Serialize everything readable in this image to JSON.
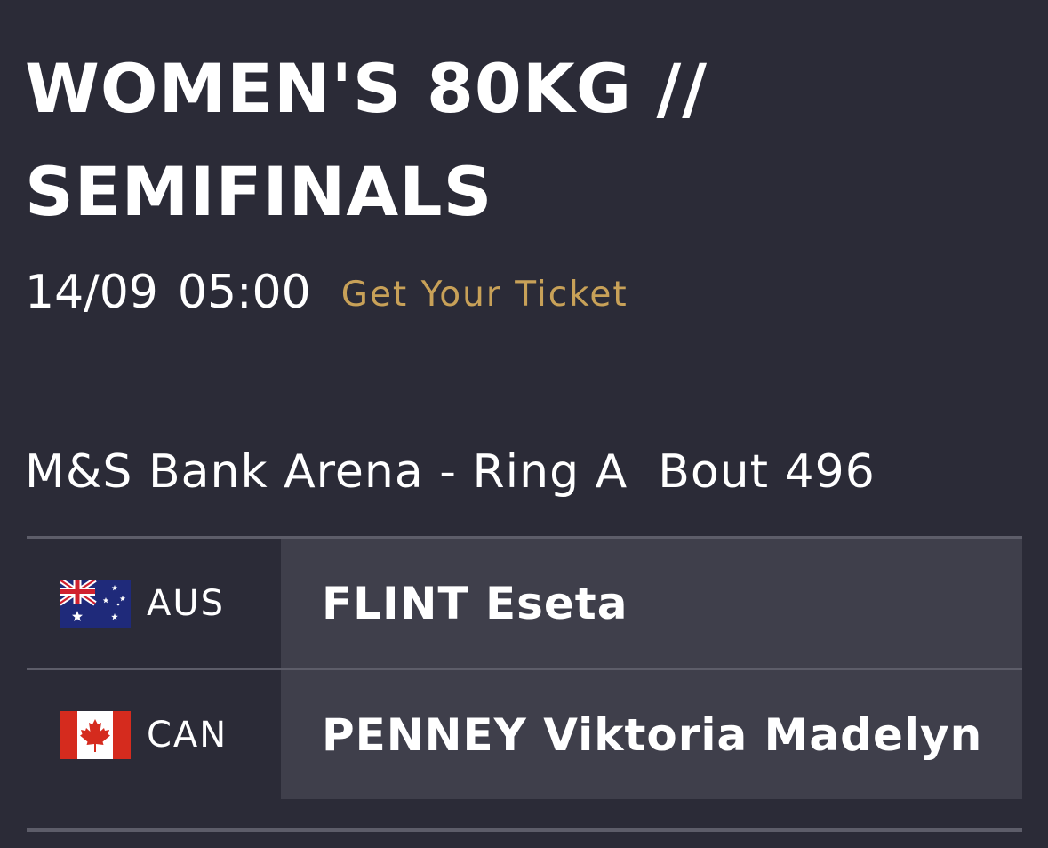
{
  "event": {
    "title": "WOMEN'S 80KG // SEMIFINALS",
    "date": "14/09",
    "time": "05:00",
    "ticket_link": "Get Your Ticket",
    "venue": "M&S Bank Arena - Ring A",
    "bout": "Bout 496"
  },
  "fighters": [
    {
      "country_code": "AUS",
      "flag_icon": "australia-flag-icon",
      "name": "FLINT Eseta"
    },
    {
      "country_code": "CAN",
      "flag_icon": "canada-flag-icon",
      "name": "PENNEY Viktoria Madelyn"
    }
  ],
  "colors": {
    "background": "#2b2b37",
    "name_cell": "#3f3f4b",
    "accent": "#c8a158",
    "divider": "#5d5d69"
  }
}
